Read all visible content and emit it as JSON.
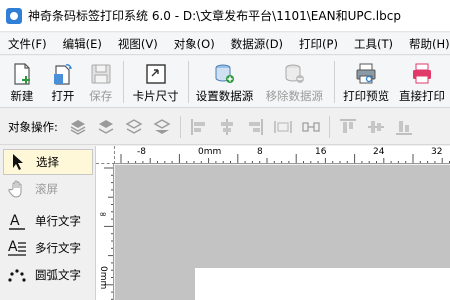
{
  "window": {
    "title": "神奇条码标签打印系统 6.0 - D:\\文章发布平台\\1101\\EAN和UPC.lbcp"
  },
  "menu": [
    "文件(F)",
    "编辑(E)",
    "视图(V)",
    "对象(O)",
    "数据源(D)",
    "打印(P)",
    "工具(T)",
    "帮助(H)"
  ],
  "toolbar": {
    "new_label": "新建",
    "open_label": "打开",
    "save_label": "保存",
    "card_size_label": "卡片尺寸",
    "set_datasource_label": "设置数据源",
    "remove_datasource_label": "移除数据源",
    "print_preview_label": "打印预览",
    "direct_print_label": "直接打印"
  },
  "object_bar": {
    "label": "对象操作:"
  },
  "toolbox": {
    "select_label": "选择",
    "scroll_label": "滚屏",
    "single_text_label": "单行文字",
    "multi_text_label": "多行文字",
    "arc_text_label": "圆弧文字"
  },
  "ruler": {
    "h_labels": [
      "-8",
      "0mm",
      "8",
      "16",
      "24",
      "32"
    ],
    "v_labels": [
      "∞",
      "0mm"
    ]
  },
  "colors": {
    "print_icon": "#e03a6a",
    "accent_blue": "#2f7fd6",
    "canvas_bg": "#c3c3c3"
  }
}
